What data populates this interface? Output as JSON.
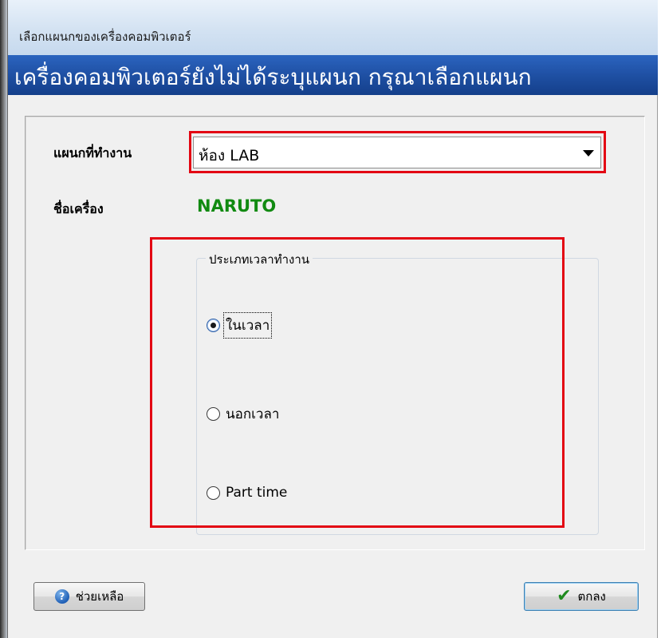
{
  "window": {
    "title": "เลือกแผนกของเครื่องคอมพิวเตอร์",
    "header": "เครื่องคอมพิวเตอร์ยังไม่ได้ระบุแผนก กรุณาเลือกแผนก"
  },
  "form": {
    "department_label": "แผนกที่ทำงาน",
    "department_value": "ห้อง LAB",
    "computer_label": "ชื่อเครื่อง",
    "computer_name": "NARUTO"
  },
  "work_time": {
    "legend": "ประเภทเวลาทำงาน",
    "options": [
      {
        "label": "ในเวลา",
        "selected": true
      },
      {
        "label": "นอกเวลา",
        "selected": false
      },
      {
        "label": "Part time",
        "selected": false
      }
    ]
  },
  "buttons": {
    "help_label": "ช่วยเหลือ",
    "ok_label": "ตกลง"
  },
  "icons": {
    "help": "help-icon",
    "ok": "checkmark-icon",
    "dropdown": "chevron-down-icon"
  },
  "colors": {
    "header_bg": "#1f50a4",
    "computer_name": "#118a11",
    "highlight": "#e30613"
  }
}
